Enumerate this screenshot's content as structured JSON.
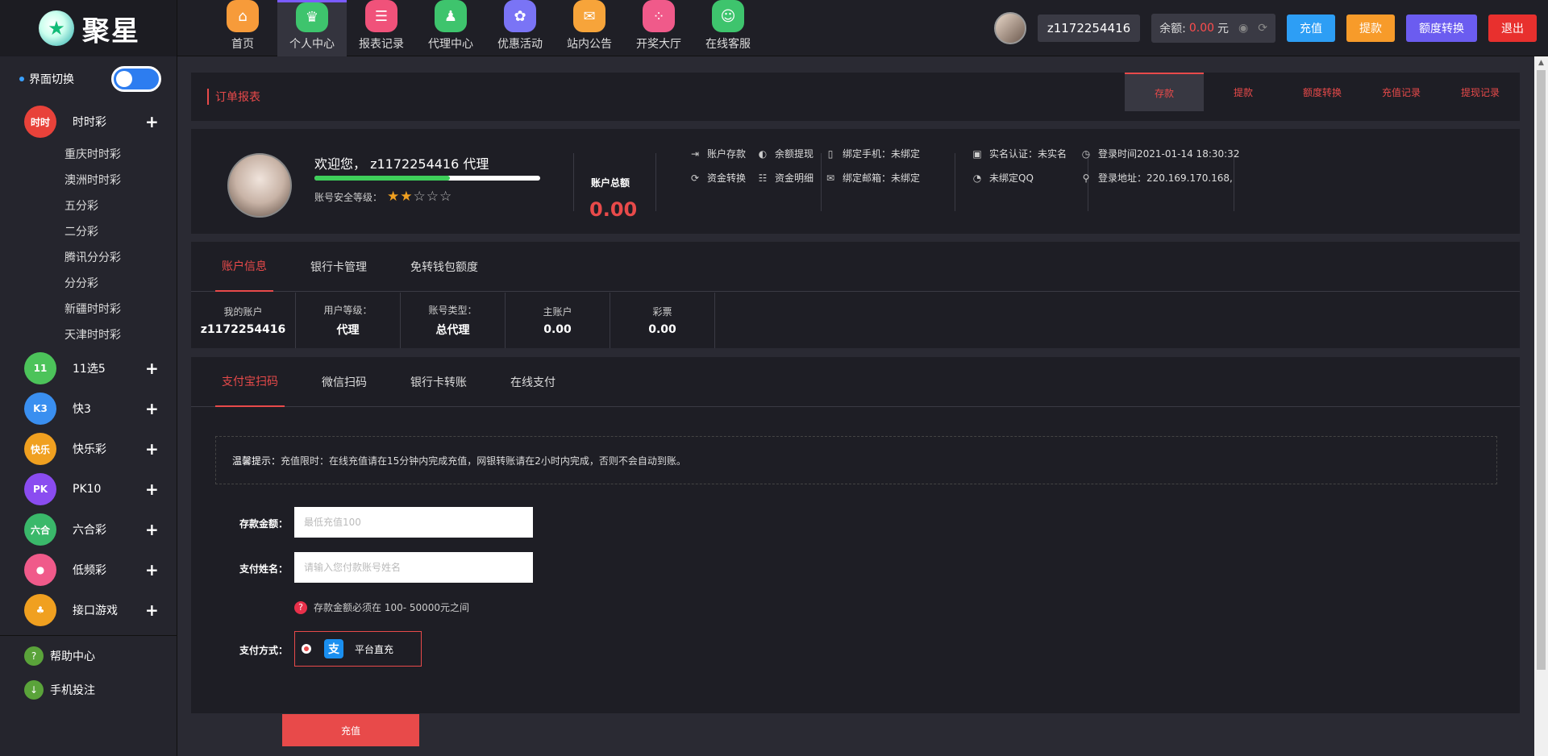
{
  "brand": {
    "name": "聚星",
    "logo_glyph": "★"
  },
  "nav": [
    {
      "label": "首页",
      "icon": "home-icon",
      "glyph": "⌂",
      "color": "#f79b3a"
    },
    {
      "label": "个人中心",
      "icon": "crown-icon",
      "glyph": "♛",
      "color": "#3ec46d",
      "active": true
    },
    {
      "label": "报表记录",
      "icon": "report-icon",
      "glyph": "☰",
      "color": "#f0527a"
    },
    {
      "label": "代理中心",
      "icon": "agent-icon",
      "glyph": "♟",
      "color": "#3ec46d"
    },
    {
      "label": "优惠活动",
      "icon": "gift-icon",
      "glyph": "✿",
      "color": "#7a74f5"
    },
    {
      "label": "站内公告",
      "icon": "mail-icon",
      "glyph": "✉",
      "color": "#f7a43a"
    },
    {
      "label": "开奖大厅",
      "icon": "grid-icon",
      "glyph": "⁘",
      "color": "#f05a8a"
    },
    {
      "label": "在线客服",
      "icon": "service-icon",
      "glyph": "☺",
      "color": "#3ec46d"
    }
  ],
  "user": {
    "username": "z1172254416",
    "balance_label": "余额:",
    "balance_value": "0.00",
    "balance_unit": "元"
  },
  "top_buttons": [
    {
      "label": "充值",
      "color": "#2d9ef5",
      "name": "recharge-top-button"
    },
    {
      "label": "提款",
      "color": "#f79b2a",
      "name": "withdraw-top-button"
    },
    {
      "label": "额度转换",
      "color": "#6b5cf0",
      "name": "transfer-top-button"
    },
    {
      "label": "退出",
      "color": "#e8302e",
      "name": "logout-button"
    }
  ],
  "sidebar": {
    "switch_label": "界面切换",
    "categories": [
      {
        "label": "时时彩",
        "icon": "shishicai-icon",
        "glyph": "时时",
        "color": "#e8423a",
        "expanded": true,
        "subs": [
          "重庆时时彩",
          "澳洲时时彩",
          "五分彩",
          "二分彩",
          "腾讯分分彩",
          "分分彩",
          "新疆时时彩",
          "天津时时彩"
        ]
      },
      {
        "label": "11选5",
        "icon": "11x5-icon",
        "glyph": "11",
        "color": "#4cc35a"
      },
      {
        "label": "快3",
        "icon": "k3-icon",
        "glyph": "K3",
        "color": "#3a8ff0"
      },
      {
        "label": "快乐彩",
        "icon": "happy-icon",
        "glyph": "快乐",
        "color": "#f0a020"
      },
      {
        "label": "PK10",
        "icon": "pk10-icon",
        "glyph": "PK",
        "color": "#8a4cf0"
      },
      {
        "label": "六合彩",
        "icon": "liuhecai-icon",
        "glyph": "六合",
        "color": "#3ab86a"
      },
      {
        "label": "低频彩",
        "icon": "lowfreq-icon",
        "glyph": "●",
        "color": "#f05a8a"
      },
      {
        "label": "接口游戏",
        "icon": "api-game-icon",
        "glyph": "♣",
        "color": "#f0a020"
      }
    ],
    "bottom": [
      {
        "label": "帮助中心",
        "icon": "help-icon",
        "glyph": "?"
      },
      {
        "label": "手机投注",
        "icon": "download-icon",
        "glyph": "↓"
      }
    ]
  },
  "order_panel": {
    "title": "订单报表",
    "tabs": [
      "存款",
      "提款",
      "额度转换",
      "充值记录",
      "提现记录"
    ],
    "active_tab": 0
  },
  "profile": {
    "welcome": "欢迎您， z1172254416 代理",
    "security_label": "账号安全等级：",
    "security_stars": 2,
    "security_stars_total": 5,
    "security_progress": 0.6,
    "total_label": "账户总额",
    "total_value": "0.00",
    "links": [
      {
        "label": "账户存款",
        "icon": "deposit-icon",
        "glyph": "⇥"
      },
      {
        "label": "余额提现",
        "icon": "withdraw-icon",
        "glyph": "◐"
      },
      {
        "label": "资金转换",
        "icon": "exchange-icon",
        "glyph": "⟳"
      },
      {
        "label": "资金明细",
        "icon": "detail-icon",
        "glyph": "☷"
      },
      {
        "label": "绑定手机：未绑定",
        "icon": "phone-icon",
        "glyph": "▯"
      },
      {
        "label": "绑定邮箱：未绑定",
        "icon": "email-icon",
        "glyph": "✉"
      },
      {
        "label": "实名认证：未实名",
        "icon": "idcard-icon",
        "glyph": "▣"
      },
      {
        "label": "未绑定QQ",
        "icon": "qq-icon",
        "glyph": "◔"
      },
      {
        "label": "登录时间2021-01-14 18:30:32",
        "icon": "clock-icon",
        "glyph": "◷"
      },
      {
        "label": "登录地址：220.169.170.168,",
        "icon": "location-icon",
        "glyph": "⚲"
      }
    ]
  },
  "account_panel": {
    "tabs": [
      "账户信息",
      "银行卡管理",
      "免转钱包额度"
    ],
    "active_tab": 0,
    "cells": [
      {
        "label": "我的账户",
        "value": "z1172254416"
      },
      {
        "label": "用户等级：",
        "value": "代理"
      },
      {
        "label": "账号类型：",
        "value": "总代理"
      },
      {
        "label": "主账户",
        "value": "0.00"
      },
      {
        "label": "彩票",
        "value": "0.00"
      }
    ]
  },
  "deposit_panel": {
    "tabs": [
      "支付宝扫码",
      "微信扫码",
      "银行卡转账",
      "在线支付"
    ],
    "active_tab": 0,
    "notice_prefix": "温馨提示：",
    "notice_text": "充值限时：在线充值请在15分钟内完成充值，网银转账请在2小时内完成，否则不会自动到账。",
    "amount_label": "存款金额：",
    "amount_placeholder": "最低充值100",
    "name_label": "支付姓名：",
    "name_placeholder": "请输入您付款账号姓名",
    "hint": "存款金额必须在 100- 50000元之间",
    "method_label": "支付方式：",
    "method_option": "平台直充",
    "submit_label": "充值"
  }
}
